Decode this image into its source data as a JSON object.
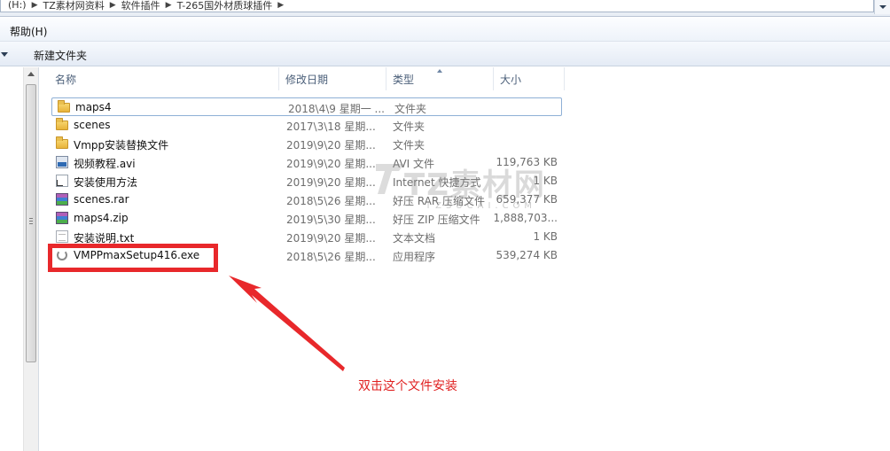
{
  "address": {
    "segments": [
      "(H:)",
      "TZ素材网资料",
      "软件插件",
      "T-265国外材质球插件"
    ]
  },
  "menu": {
    "help_label": "帮助(H)"
  },
  "toolbar": {
    "new_folder_label": "新建文件夹"
  },
  "columns": {
    "name": "名称",
    "date": "修改日期",
    "type": "类型",
    "size": "大小"
  },
  "files": [
    {
      "name": "maps4",
      "date": "2018\\4\\9 星期一 ...",
      "type": "文件夹",
      "size": "",
      "icon": "folder-icon"
    },
    {
      "name": "scenes",
      "date": "2017\\3\\18 星期...",
      "type": "文件夹",
      "size": "",
      "icon": "folder-icon"
    },
    {
      "name": "Vmpp安装替换文件",
      "date": "2019\\9\\20 星期...",
      "type": "文件夹",
      "size": "",
      "icon": "folder-icon"
    },
    {
      "name": "视频教程.avi",
      "date": "2019\\9\\20 星期...",
      "type": "AVI 文件",
      "size": "119,763 KB",
      "icon": "video-file-icon"
    },
    {
      "name": "安装使用方法",
      "date": "2019\\9\\20 星期...",
      "type": "Internet 快捷方式",
      "size": "1 KB",
      "icon": "shortcut-icon"
    },
    {
      "name": "scenes.rar",
      "date": "2018\\5\\26 星期...",
      "type": "好压 RAR 压缩文件",
      "size": "659,377 KB",
      "icon": "archive-icon"
    },
    {
      "name": "maps4.zip",
      "date": "2019\\5\\30 星期...",
      "type": "好压 ZIP 压缩文件",
      "size": "1,888,703...",
      "icon": "archive-icon"
    },
    {
      "name": "安装说明.txt",
      "date": "2019\\9\\20 星期...",
      "type": "文本文档",
      "size": "1 KB",
      "icon": "text-file-icon"
    },
    {
      "name": "VMPPmaxSetup416.exe",
      "date": "2018\\5\\26 星期...",
      "type": "应用程序",
      "size": "539,274 KB",
      "icon": "installer-icon"
    }
  ],
  "annotation": {
    "text": "双击这个文件安装",
    "color": "#e02020"
  },
  "watermark": {
    "main": "TZ素材网",
    "sub": "TZSUCAI.COM"
  },
  "colors": {
    "highlight_red": "#e8282b",
    "selection_border": "#8fb0d6",
    "header_text": "#4c607a"
  }
}
